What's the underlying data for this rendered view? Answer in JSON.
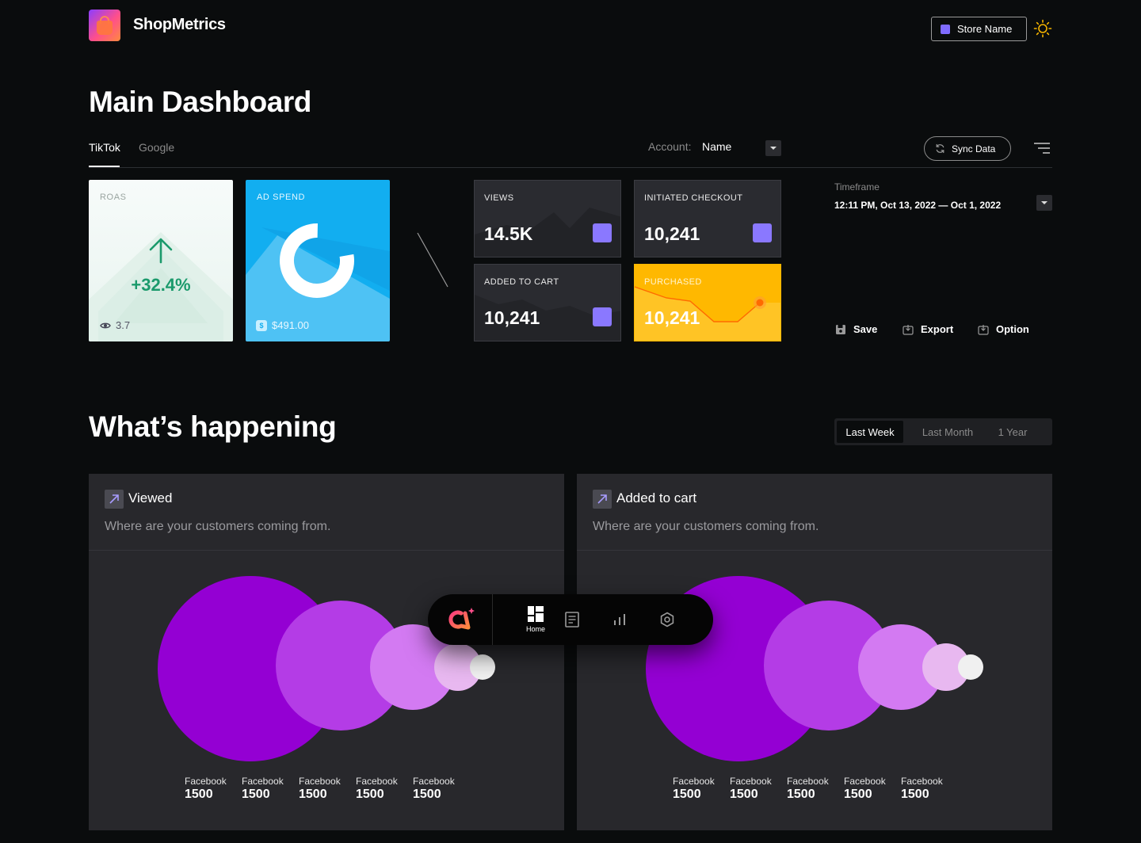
{
  "header": {
    "brand": "ShopMetrics",
    "store_button": "Store Name"
  },
  "main": {
    "title": "Main Dashboard",
    "tabs": [
      {
        "label": "TikTok",
        "active": true
      },
      {
        "label": "Google",
        "active": false
      }
    ],
    "account": {
      "label": "Account:",
      "value": "Name"
    },
    "sync_button": "Sync Data"
  },
  "cards": {
    "roas": {
      "label": "ROAS",
      "value": "+32.4%",
      "footer": "3.7"
    },
    "ad_spend": {
      "label": "AD SPEND",
      "footer": "$491.00",
      "donut_fraction": 0.78
    },
    "views": {
      "label": "VIEWS",
      "value": "14.5K"
    },
    "initiated_checkout": {
      "label": "INITIATED CHECKOUT",
      "value": "10,241"
    },
    "added_to_cart": {
      "label": "ADDED TO CART",
      "value": "10,241"
    },
    "purchased": {
      "label": "PURCHASED",
      "value": "10,241"
    }
  },
  "timeframe": {
    "label": "Timeframe",
    "value": "12:11 PM, Oct 13, 2022 — Oct 1, 2022",
    "actions": {
      "save": "Save",
      "export": "Export",
      "option": "Option"
    }
  },
  "happening": {
    "title": "What’s happening",
    "periods": [
      {
        "label": "Last Week",
        "active": true
      },
      {
        "label": "Last Month",
        "active": false
      },
      {
        "label": "1 Year",
        "active": false
      }
    ],
    "panels": [
      {
        "title": "Viewed",
        "subtitle": "Where are your customers coming from.",
        "sources": [
          {
            "name": "Facebook",
            "value": "1500"
          },
          {
            "name": "Facebook",
            "value": "1500"
          },
          {
            "name": "Facebook",
            "value": "1500"
          },
          {
            "name": "Facebook",
            "value": "1500"
          },
          {
            "name": "Facebook",
            "value": "1500"
          }
        ]
      },
      {
        "title": "Added to cart",
        "subtitle": "Where are your customers coming from.",
        "sources": [
          {
            "name": "Facebook",
            "value": "1500"
          },
          {
            "name": "Facebook",
            "value": "1500"
          },
          {
            "name": "Facebook",
            "value": "1500"
          },
          {
            "name": "Facebook",
            "value": "1500"
          },
          {
            "name": "Facebook",
            "value": "1500"
          }
        ]
      }
    ]
  },
  "dock": {
    "items": [
      {
        "icon": "app-logo-icon"
      },
      {
        "icon": "home-icon",
        "label": "Home",
        "active": true
      },
      {
        "icon": "document-icon"
      },
      {
        "icon": "bar-chart-icon"
      },
      {
        "icon": "settings-icon"
      }
    ]
  },
  "colors": {
    "background": "#0a0c0d",
    "accent_purple": "#8a78ff",
    "roas_green": "#1b9a6c",
    "ad_spend_blue": "#12aef0",
    "purchased_yellow": "#ffb800",
    "bubble_colors": [
      "#9400d3",
      "#b43ce6",
      "#d37af2",
      "#e8b8f0",
      "#f0f0f0"
    ]
  }
}
